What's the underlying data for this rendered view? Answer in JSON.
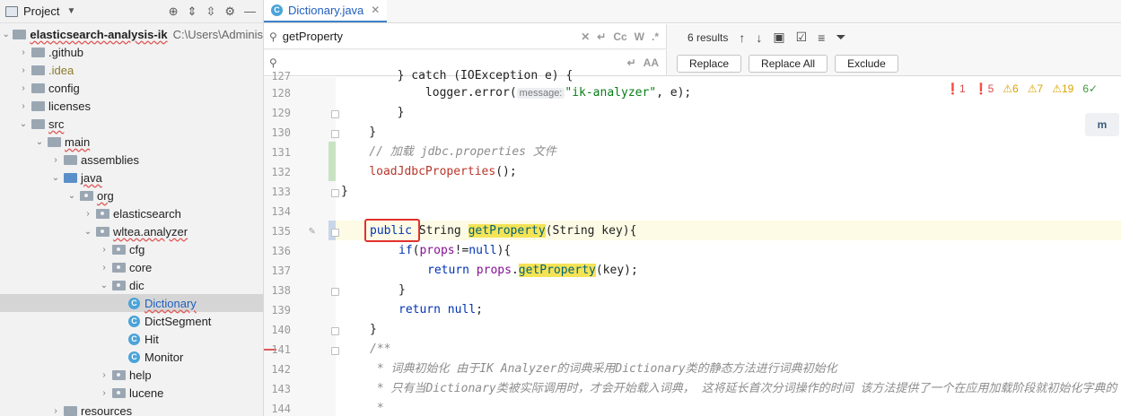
{
  "project_panel": {
    "title": "Project",
    "items": [
      {
        "label": "elasticsearch-analysis-ik",
        "path": "C:\\Users\\Adminis"
      },
      {
        "label": ".github"
      },
      {
        "label": ".idea"
      },
      {
        "label": "config"
      },
      {
        "label": "licenses"
      },
      {
        "label": "src"
      },
      {
        "label": "main"
      },
      {
        "label": "assemblies"
      },
      {
        "label": "java"
      },
      {
        "label": "org"
      },
      {
        "label": "elasticsearch"
      },
      {
        "label": "wltea.analyzer"
      },
      {
        "label": "cfg"
      },
      {
        "label": "core"
      },
      {
        "label": "dic"
      },
      {
        "label": "Dictionary"
      },
      {
        "label": "DictSegment"
      },
      {
        "label": "Hit"
      },
      {
        "label": "Monitor"
      },
      {
        "label": "help"
      },
      {
        "label": "lucene"
      },
      {
        "label": "resources"
      }
    ]
  },
  "editor": {
    "tab_label": "Dictionary.java",
    "class_icon_letter": "C",
    "search": {
      "query": "getProperty",
      "replace_value": "",
      "result_count": "6 results",
      "opt_case": "Cc",
      "opt_word": "W",
      "opt_regex": ".*",
      "replace_label": "Replace",
      "replace_all_label": "Replace All",
      "exclude_label": "Exclude"
    },
    "inspections": {
      "errors": "1",
      "errors2": "5",
      "warn1": "6",
      "warn2": "7",
      "warn3": "19",
      "ok": "6"
    },
    "badge": "m",
    "line_numbers": [
      "127",
      "128",
      "129",
      "130",
      "131",
      "132",
      "133",
      "134",
      "135",
      "136",
      "137",
      "138",
      "139",
      "140",
      "141",
      "142",
      "143",
      "144"
    ],
    "code": {
      "l127": "        } catch (IOException e) {",
      "l128_a": "            logger.error(",
      "l128_hint": "message:",
      "l128_str": "\"ik-analyzer\"",
      "l128_b": ", e);",
      "l129": "        }",
      "l130": "    }",
      "l131": "    // 加载 jdbc.properties 文件",
      "l132_fn": "loadJdbcProperties",
      "l132_b": "();",
      "l133": "}",
      "l135_kw": "public",
      "l135_a": " String ",
      "l135_hl": "getProperty",
      "l135_b": "(String key){",
      "l136_kw": "if",
      "l136_a": "(",
      "l136_fld": "props",
      "l136_b": "!=",
      "l136_kw2": "null",
      "l136_c": "){",
      "l137_kw": "return",
      "l137_a": " ",
      "l137_fld": "props",
      "l137_b": ".",
      "l137_hl": "getProperty",
      "l137_c": "(key);",
      "l138": "}",
      "l139_kw": "return",
      "l139_a": " ",
      "l139_kw2": "null",
      "l139_b": ";",
      "l140": "}",
      "l141": "/**",
      "l142": " * 词典初始化 由于IK Analyzer的词典采用Dictionary类的静态方法进行词典初始化",
      "l143": " * 只有当Dictionary类被实际调用时，才会开始载入词典， 这将延长首次分词操作的时间 该方法提供了一个在应用加载阶段就初始化字典的",
      "l144": " *"
    }
  }
}
